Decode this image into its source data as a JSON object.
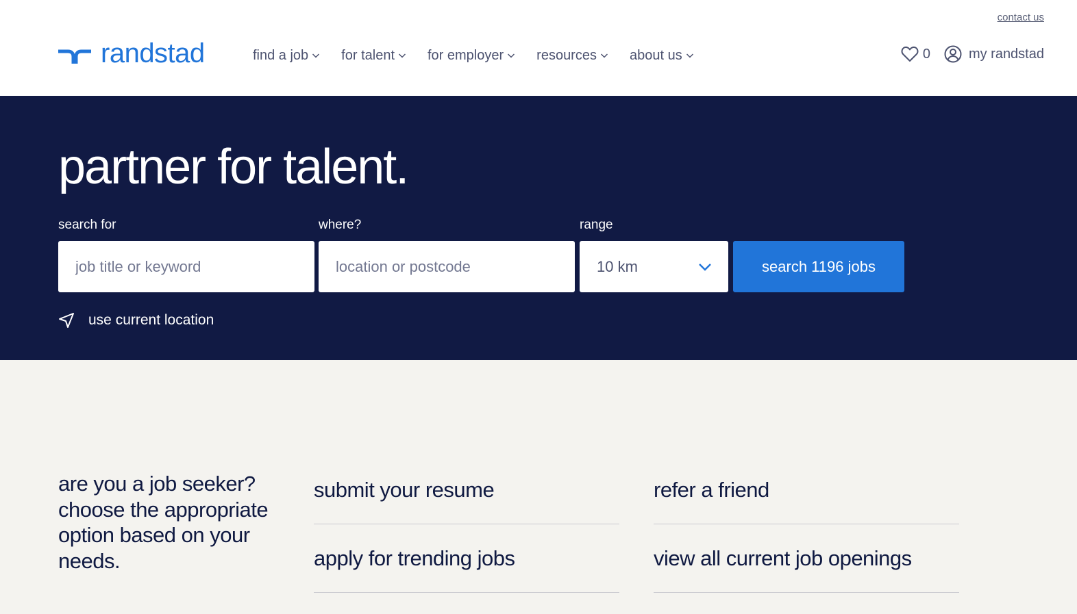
{
  "header": {
    "contact_label": "contact us",
    "logo_text": "randstad",
    "nav": [
      {
        "label": "find a job"
      },
      {
        "label": "for talent"
      },
      {
        "label": "for employer"
      },
      {
        "label": "resources"
      },
      {
        "label": "about us"
      }
    ],
    "favorites_count": "0",
    "my_randstad_label": "my randstad"
  },
  "hero": {
    "title": "partner for talent.",
    "search_label": "search for",
    "search_placeholder": "job title or keyword",
    "where_label": "where?",
    "where_placeholder": "location or postcode",
    "range_label": "range",
    "range_value": "10 km",
    "search_button": "search 1196 jobs",
    "use_location_label": "use current location"
  },
  "lower": {
    "intro": "are you a job seeker? choose the appropriate option based on your needs.",
    "column1": [
      "submit your resume",
      "apply for trending jobs"
    ],
    "column2": [
      "refer a friend",
      "view all current job openings"
    ]
  },
  "colors": {
    "brand_blue": "#2175d9",
    "hero_navy": "#111a44",
    "lower_bg": "#f4f3ef"
  },
  "icons": [
    "randstad-logo-icon",
    "chevron-down-icon",
    "heart-icon",
    "user-circle-icon",
    "location-arrow-icon"
  ]
}
